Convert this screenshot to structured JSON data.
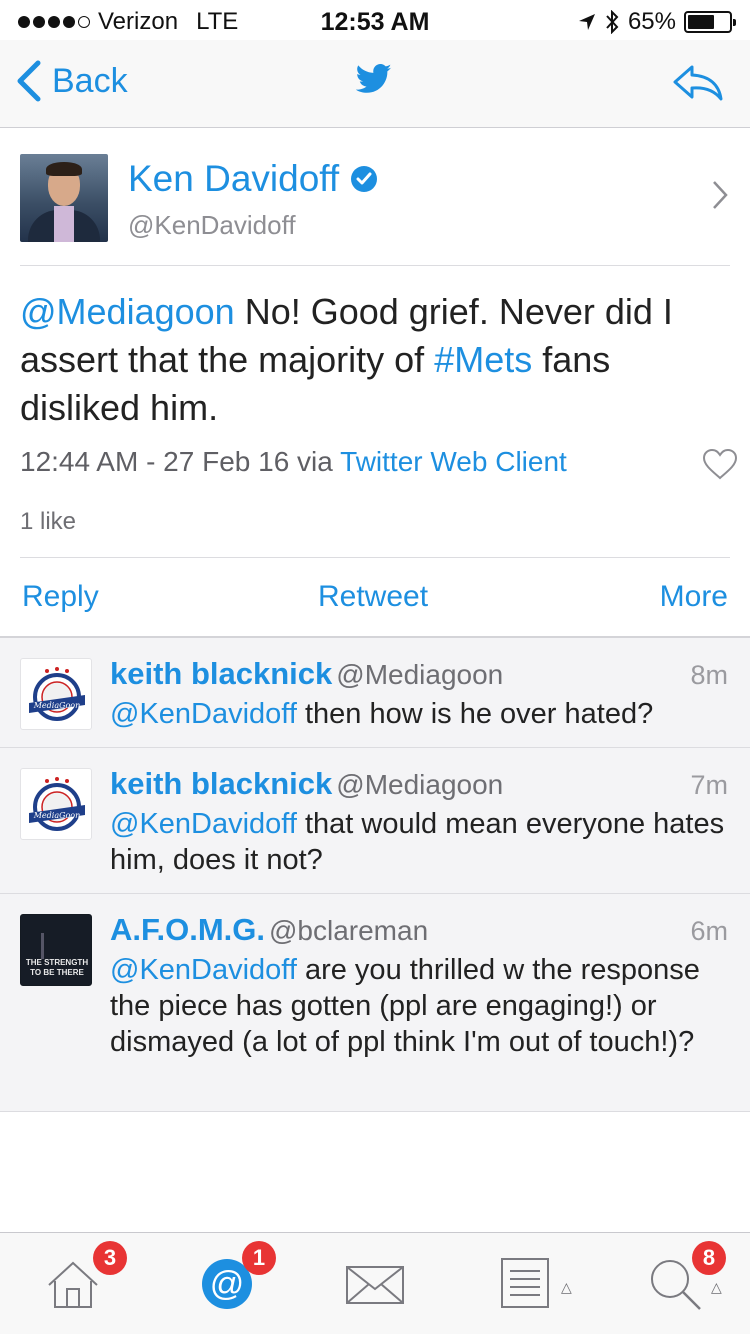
{
  "status_bar": {
    "carrier": "Verizon",
    "network": "LTE",
    "time": "12:53 AM",
    "battery_percent": "65%",
    "battery_level": 0.65,
    "signal_bars": 4
  },
  "nav": {
    "back_label": "Back",
    "center_icon": "twitter-bird-icon",
    "right_icon": "reply-arrow-icon"
  },
  "author": {
    "name": "Ken Davidoff",
    "handle": "@KenDavidoff",
    "verified": true
  },
  "tweet": {
    "mention": "@Mediagoon",
    "text_part1": " No! Good grief. Never did I assert that the majority of ",
    "hashtag": "#Mets",
    "text_part2": " fans disliked him.",
    "timestamp": "12:44 AM - 27 Feb 16 via ",
    "client": "Twitter Web Client",
    "likes": "1 like"
  },
  "actions": {
    "reply": "Reply",
    "retweet": "Retweet",
    "more": "More"
  },
  "replies": [
    {
      "name": "keith blacknick",
      "handle": "@Mediagoon",
      "time": "8m",
      "mention": "@KenDavidoff",
      "text": " then how is he over hated?"
    },
    {
      "name": "keith blacknick",
      "handle": "@Mediagoon",
      "time": "7m",
      "mention": "@KenDavidoff",
      "text": " that would mean everyone hates him, does it not?"
    },
    {
      "name": "A.F.O.M.G.",
      "handle": "@bclareman",
      "time": "6m",
      "mention": "@KenDavidoff",
      "text": " are you thrilled w the response the piece has gotten (ppl are engaging!) or dismayed (a lot of ppl think I'm out of touch!)?",
      "avatar_text_1": "THE STRENGTH",
      "avatar_text_2": "TO BE THERE"
    }
  ],
  "tabbar": {
    "home_badge": "3",
    "mentions_badge": "1",
    "search_badge": "8",
    "tabs": [
      "home-icon",
      "at-mention-icon",
      "envelope-icon",
      "list-icon",
      "search-icon"
    ]
  },
  "colors": {
    "link": "#1d8fe0",
    "badge": "#e83434"
  }
}
